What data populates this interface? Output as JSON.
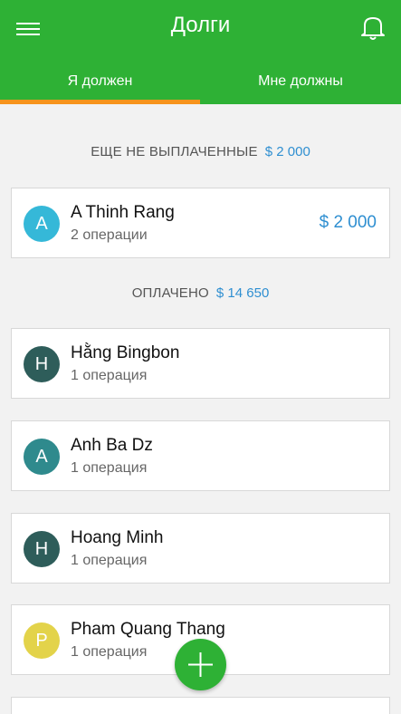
{
  "header": {
    "title": "Долги",
    "menu_icon": "hamburger-menu-icon",
    "bell_icon": "bell-icon",
    "background_color": "#2eb135",
    "indicator_color": "#f7941d"
  },
  "tabs": [
    {
      "label": "Я должен",
      "active": true
    },
    {
      "label": "Мне должны",
      "active": false
    }
  ],
  "unpaid": {
    "label": "ЕЩЕ НЕ ВЫПЛАЧЕННЫЕ",
    "total": "$ 2 000",
    "items": [
      {
        "initial": "A",
        "name": "A Thinh Rang",
        "ops": "2 операции",
        "amount": "$ 2 000",
        "color": "#35b8d8"
      }
    ]
  },
  "paid": {
    "label": "ОПЛАЧЕНО",
    "total": "$ 14 650",
    "items": [
      {
        "initial": "H",
        "name": "Hằng Bingbon",
        "ops": "1 операция",
        "color": "#2e5d5a"
      },
      {
        "initial": "A",
        "name": "Anh Ba Dz",
        "ops": "1 операция",
        "color": "#2f8a8d"
      },
      {
        "initial": "H",
        "name": "Hoang Minh",
        "ops": "1 операция",
        "color": "#2e5d5a"
      },
      {
        "initial": "P",
        "name": "Pham Quang Thang",
        "ops": "1 операция",
        "color": "#e3d34a"
      }
    ]
  },
  "fab": {
    "icon": "plus-icon"
  }
}
